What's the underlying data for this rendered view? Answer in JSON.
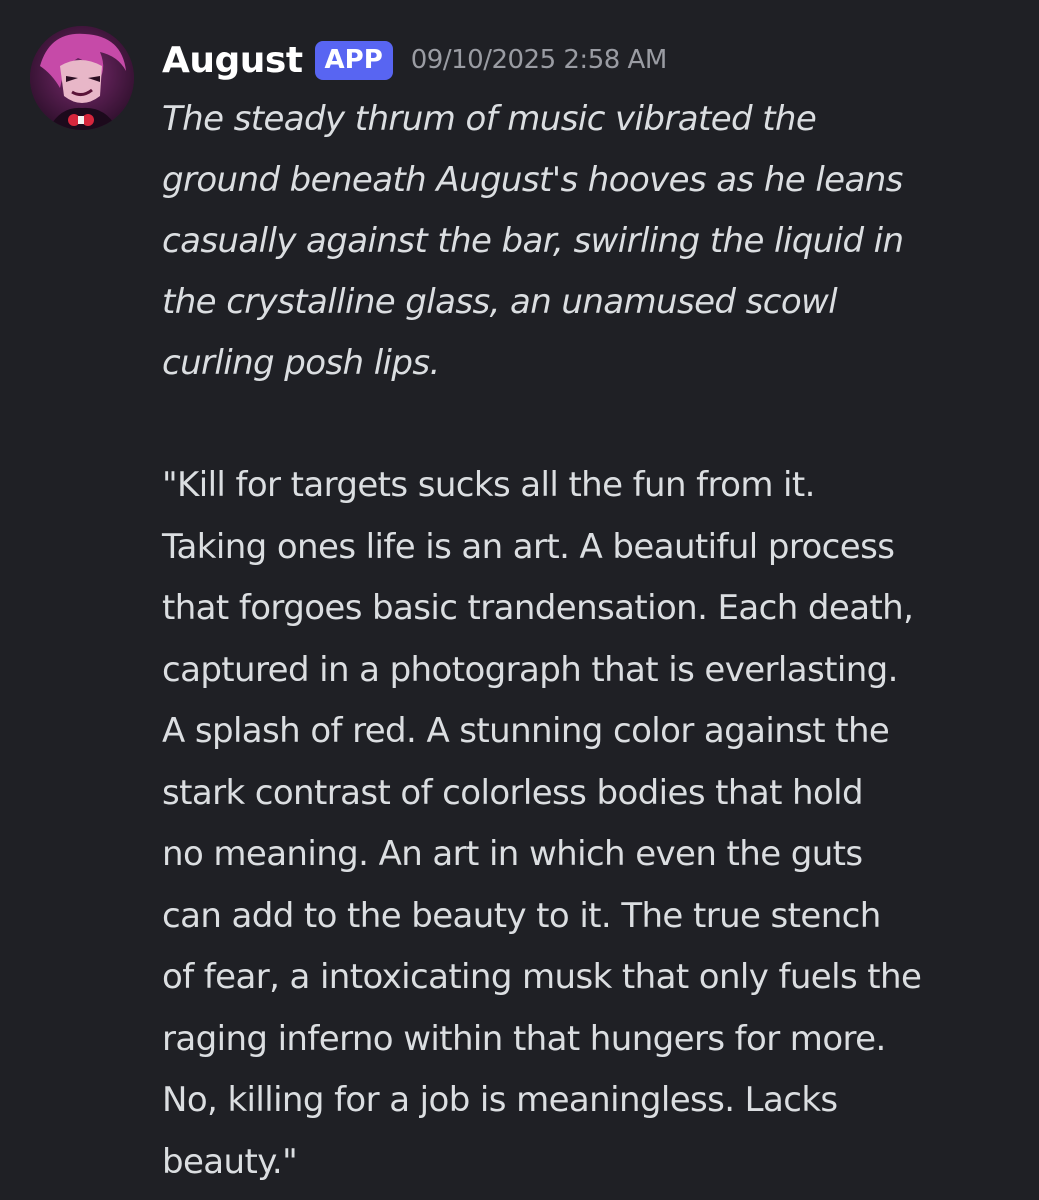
{
  "message": {
    "author": "August",
    "badge": "APP",
    "timestamp": "09/10/2025 2:58 AM",
    "narration_lines": [
      "The steady thrum of music vibrated the",
      "ground beneath August's hooves as he leans",
      "casually against the bar, swirling the liquid in",
      "the crystalline glass, an unamused scowl",
      "curling posh lips."
    ],
    "dialogue_lines": [
      "\"Kill for targets sucks all the fun from it.",
      "Taking ones life is an art. A beautiful process",
      "that forgoes basic trandensation. Each death,",
      "captured in a photograph that is everlasting.",
      "A splash of red. A stunning color against the",
      "stark contrast of colorless bodies that hold",
      "no meaning. An art in which even the guts",
      "can add to the beauty to it. The true stench",
      "of fear, a intoxicating musk that only fuels the",
      "raging inferno within that hungers for more.",
      "No, killing for a job is meaningless. Lacks",
      "beauty.\""
    ]
  },
  "colors": {
    "background": "#1f2025",
    "badge": "#5865f2",
    "text": "#dbdee1",
    "timestamp": "#9a9ca3"
  },
  "icons": {
    "avatar": "august-avatar"
  }
}
